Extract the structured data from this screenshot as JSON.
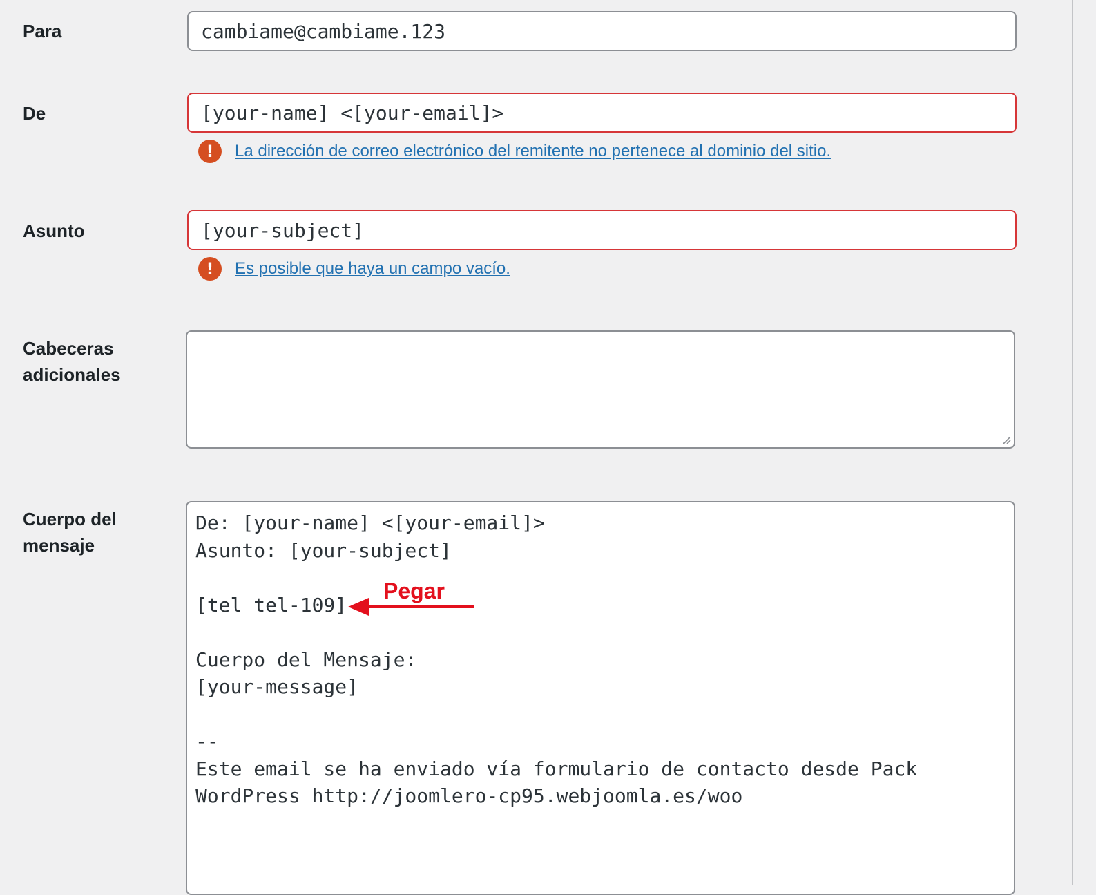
{
  "fields": {
    "to": {
      "label": "Para",
      "value": "cambiame@cambiame.123"
    },
    "from": {
      "label": "De",
      "value": "[your-name] <[your-email]>",
      "error": "La dirección de correo electrónico del remitente no pertenece al dominio del sitio."
    },
    "subject": {
      "label": "Asunto",
      "value": "[your-subject]",
      "error": "Es posible que haya un campo vacío."
    },
    "headers": {
      "label_line1": "Cabeceras",
      "label_line2": "adicionales",
      "value": ""
    },
    "body": {
      "label_line1": "Cuerpo del",
      "label_line2": "mensaje",
      "lines": [
        "De: [your-name] <[your-email]>",
        "Asunto: [your-subject]",
        "",
        "[tel tel-109]",
        "",
        "Cuerpo del Mensaje:",
        "[your-message]",
        "",
        "--",
        "Este email se ha enviado vía formulario de contacto desde Pack",
        "WordPress http://joomlero-cp95.webjoomla.es/woo"
      ]
    }
  },
  "annotation": {
    "text": "Pegar",
    "color": "#e3101d"
  },
  "colors": {
    "error": "#d54e21",
    "invalid_border": "#d63638",
    "link": "#2271b1",
    "background": "#f0f0f1"
  },
  "icons": {
    "error": "exclamation-circle-icon",
    "resize": "resize-grip-icon",
    "arrow": "arrow-left-icon"
  }
}
